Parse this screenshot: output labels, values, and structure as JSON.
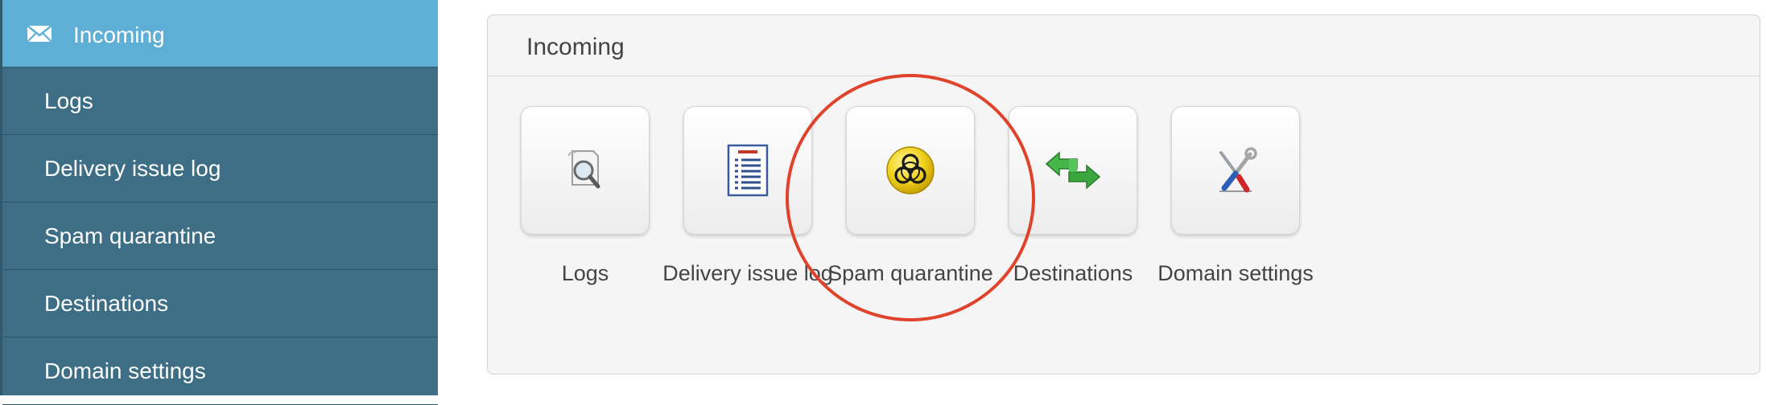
{
  "sidebar": {
    "header": {
      "title": "Incoming",
      "icon": "envelope-icon"
    },
    "items": [
      {
        "label": "Logs"
      },
      {
        "label": "Delivery issue log"
      },
      {
        "label": "Spam quarantine"
      },
      {
        "label": "Destinations"
      },
      {
        "label": "Domain settings"
      }
    ]
  },
  "panel": {
    "title": "Incoming",
    "tiles": [
      {
        "label": "Logs",
        "icon": "magnifier-document-icon"
      },
      {
        "label": "Delivery issue log",
        "icon": "report-document-icon"
      },
      {
        "label": "Spam quarantine",
        "icon": "biohazard-icon"
      },
      {
        "label": "Destinations",
        "icon": "green-arrows-icon"
      },
      {
        "label": "Domain settings",
        "icon": "tools-icon"
      }
    ]
  },
  "colors": {
    "sidebar_bg": "#3d6e85",
    "sidebar_active": "#5eaed6",
    "highlight": "#e0432b",
    "panel_bg": "#f5f5f5"
  }
}
